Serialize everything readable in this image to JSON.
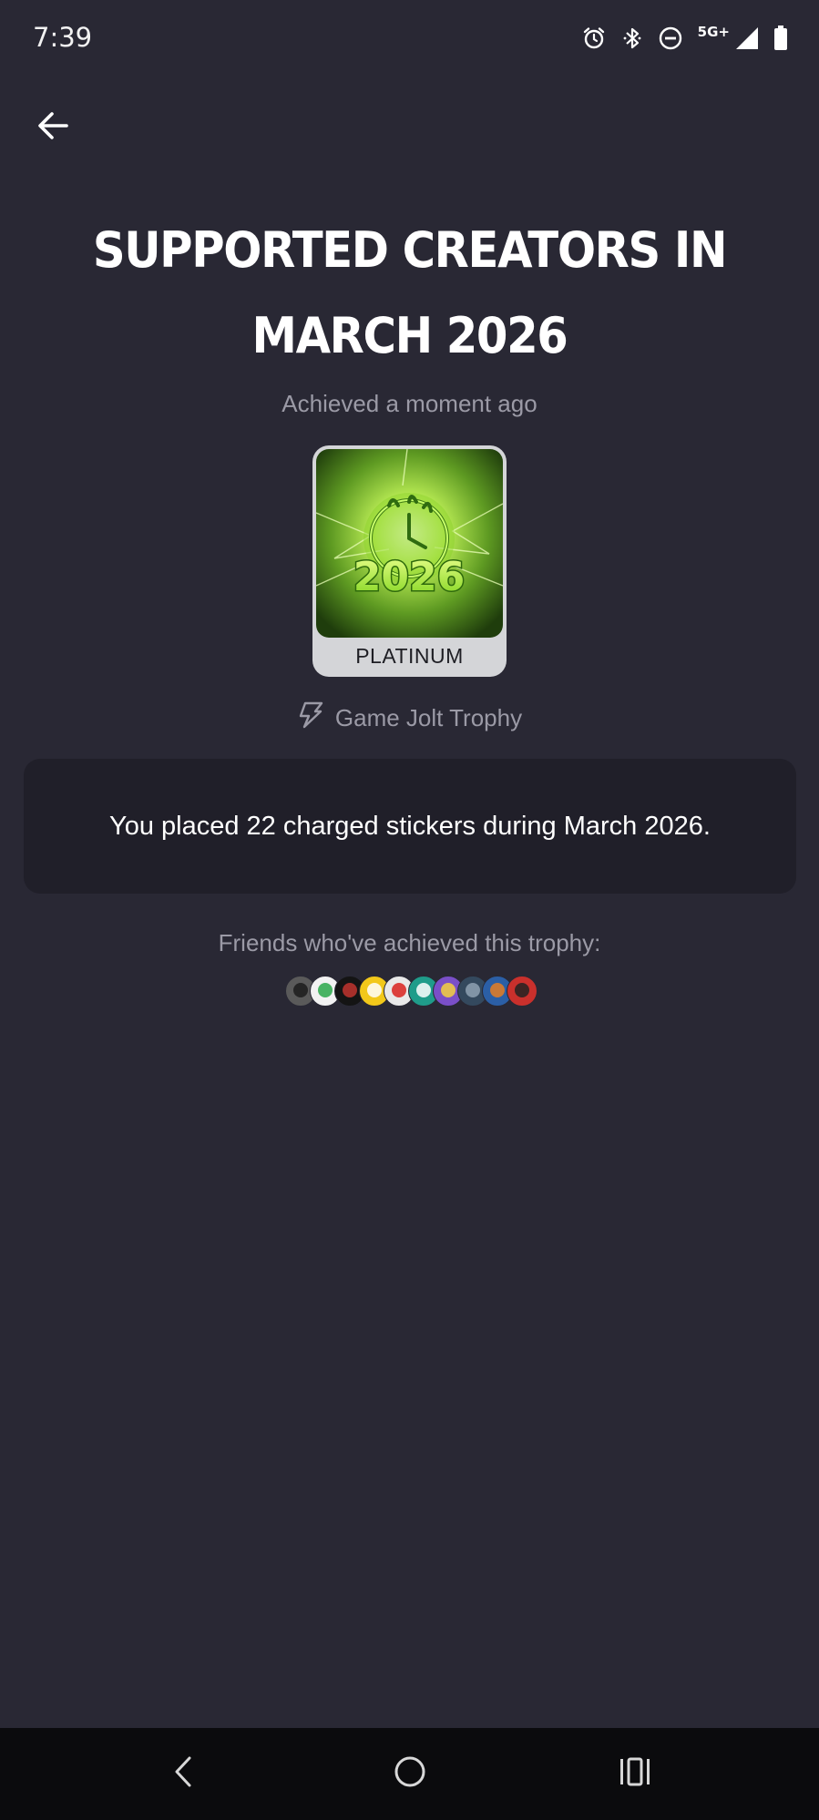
{
  "status_bar": {
    "time": "7:39",
    "network_label": "5G+",
    "icons": [
      "alarm-icon",
      "bluetooth-icon",
      "do-not-disturb-icon",
      "signal-icon",
      "battery-icon"
    ]
  },
  "header": {
    "back_icon": "arrow-left-icon"
  },
  "trophy": {
    "title": "Supported Creators in March 2026",
    "achieved": "Achieved a moment ago",
    "image_label": "2026",
    "tier": "PLATINUM",
    "type_icon": "game-jolt-icon",
    "type": "Game Jolt Trophy",
    "description": "You placed 22 charged stickers during March 2026."
  },
  "friends": {
    "label": "Friends who've achieved this trophy:",
    "avatars": [
      {
        "color": "#5a5a5a",
        "accent": "#1c1c1c"
      },
      {
        "color": "#f2f2f2",
        "accent": "#2aa84a"
      },
      {
        "color": "#141414",
        "accent": "#c0342e"
      },
      {
        "color": "#f2c81a",
        "accent": "#ffffff"
      },
      {
        "color": "#e9e9e9",
        "accent": "#d9221f"
      },
      {
        "color": "#1f9c8a",
        "accent": "#ffffff"
      },
      {
        "color": "#7a4fc8",
        "accent": "#f4d03f"
      },
      {
        "color": "#34495e",
        "accent": "#8fa1b3"
      },
      {
        "color": "#2b5fa6",
        "accent": "#e67e22"
      },
      {
        "color": "#c9302c",
        "accent": "#222222"
      }
    ]
  },
  "nav_bar": {
    "icons": [
      "back-nav-icon",
      "home-nav-icon",
      "recents-nav-icon"
    ]
  },
  "colors": {
    "background": "#292834",
    "card": "#201f29",
    "muted_text": "#9b9aa6",
    "tier_badge": "#d4d5d8"
  }
}
